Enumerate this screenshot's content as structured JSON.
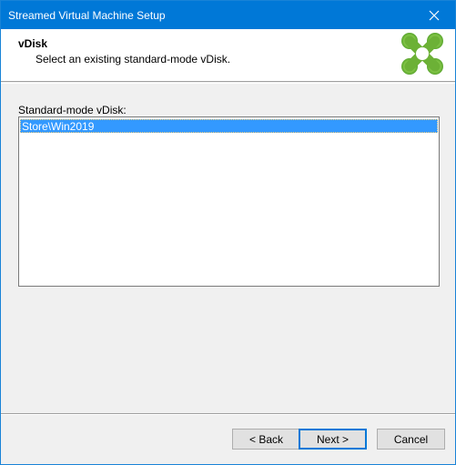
{
  "window": {
    "title": "Streamed Virtual Machine Setup"
  },
  "header": {
    "title": "vDisk",
    "subtitle": "Select an existing standard-mode vDisk.",
    "logo_colors": {
      "green_dark": "#3f8f1f",
      "green_light": "#8fd14f"
    }
  },
  "vdisk_list": {
    "label": "Standard-mode vDisk:",
    "items": [
      {
        "label": "Store\\Win2019",
        "selected": true
      }
    ]
  },
  "buttons": {
    "back": "< Back",
    "next": "Next >",
    "cancel": "Cancel"
  },
  "colors": {
    "titlebar": "#0078d7",
    "selection": "#3399ff",
    "default_button_border": "#0078d7"
  }
}
